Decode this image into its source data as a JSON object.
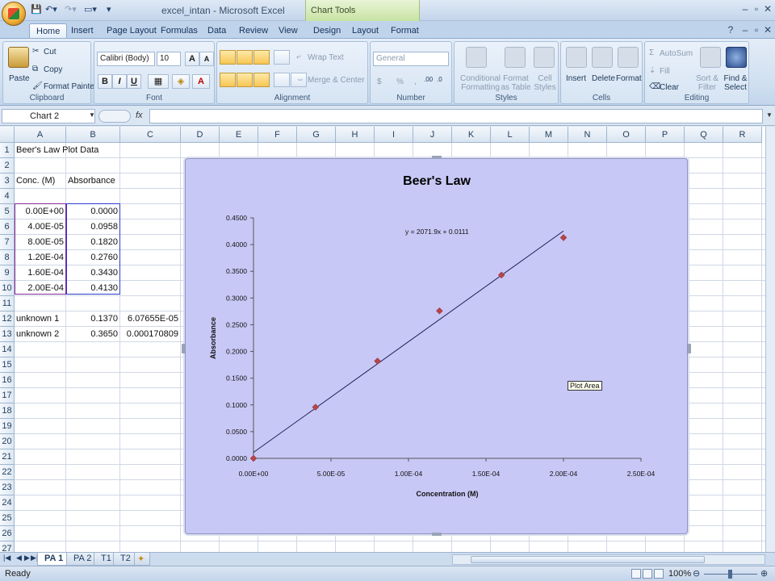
{
  "window": {
    "title": "excel_intan - Microsoft Excel",
    "contextual_tab": "Chart Tools"
  },
  "ribbon_tabs": [
    "Home",
    "Insert",
    "Page Layout",
    "Formulas",
    "Data",
    "Review",
    "View",
    "Design",
    "Layout",
    "Format"
  ],
  "ribbon": {
    "clipboard": {
      "paste": "Paste",
      "cut": "Cut",
      "copy": "Copy",
      "format_painter": "Format Painter",
      "label": "Clipboard"
    },
    "font": {
      "font_name": "Calibri (Body)",
      "font_size": "10",
      "bold": "B",
      "italic": "I",
      "underline": "U",
      "label": "Font"
    },
    "alignment": {
      "wrap_text": "Wrap Text",
      "merge_center": "Merge & Center",
      "label": "Alignment"
    },
    "number": {
      "format": "General",
      "currency": "$",
      "percent": "%",
      "comma": ",",
      "label": "Number"
    },
    "styles": {
      "conditional": "Conditional Formatting",
      "format_table": "Format as Table",
      "cell_styles": "Cell Styles",
      "label": "Styles"
    },
    "cells": {
      "insert": "Insert",
      "delete": "Delete",
      "format": "Format",
      "label": "Cells"
    },
    "editing": {
      "autosum": "AutoSum",
      "fill": "Fill",
      "clear": "Clear",
      "sort_filter": "Sort & Filter",
      "find_select": "Find & Select",
      "label": "Editing"
    }
  },
  "formula_bar": {
    "name_box": "Chart 2",
    "fx": "fx",
    "content": ""
  },
  "columns": [
    "A",
    "B",
    "C",
    "D",
    "E",
    "F",
    "G",
    "H",
    "I",
    "J",
    "K",
    "L",
    "M",
    "N",
    "O",
    "P",
    "Q",
    "R"
  ],
  "rows": [
    "1",
    "2",
    "3",
    "4",
    "5",
    "6",
    "7",
    "8",
    "9",
    "10",
    "11",
    "12",
    "13",
    "14",
    "15",
    "16",
    "17",
    "18",
    "19",
    "20",
    "21",
    "22",
    "23",
    "24",
    "25",
    "26",
    "27"
  ],
  "cells": {
    "A1": "Beer's Law Plot Data",
    "A3": "Conc. (M)",
    "B3": "Absorbance",
    "A5": "0.00E+00",
    "B5": "0.0000",
    "A6": "4.00E-05",
    "B6": "0.0958",
    "A7": "8.00E-05",
    "B7": "0.1820",
    "A8": "1.20E-04",
    "B8": "0.2760",
    "A9": "1.60E-04",
    "B9": "0.3430",
    "A10": "2.00E-04",
    "B10": "0.4130",
    "A12": "unknown 1",
    "B12": "0.1370",
    "C12": "6.07655E-05",
    "A13": "unknown 2",
    "B13": "0.3650",
    "C13": "0.000170809"
  },
  "chart_data": {
    "type": "scatter",
    "title": "Beer's Law",
    "xlabel": "Concentration (M)",
    "ylabel": "Absorbance",
    "x": [
      0,
      4e-05,
      8e-05,
      0.00012,
      0.00016,
      0.0002
    ],
    "y": [
      0,
      0.0958,
      0.182,
      0.276,
      0.343,
      0.413
    ],
    "trendline": {
      "slope": 2071.9,
      "intercept": 0.0111,
      "label": "y = 2071.9x + 0.0111"
    },
    "xlim": [
      0,
      0.00025
    ],
    "ylim": [
      0,
      0.45
    ],
    "xticks": [
      "0.00E+00",
      "5.00E-05",
      "1.00E-04",
      "1.50E-04",
      "2.00E-04",
      "2.50E-04"
    ],
    "yticks": [
      "0.0000",
      "0.0500",
      "0.1000",
      "0.1500",
      "0.2000",
      "0.2500",
      "0.3000",
      "0.3500",
      "0.4000",
      "0.4500"
    ],
    "grid": false,
    "marker_color": "#b5454a",
    "background": "#c8c8f6"
  },
  "tooltip": "Plot Area",
  "sheet_tabs": [
    "PA 1",
    "PA 2",
    "T1",
    "T2"
  ],
  "status": {
    "ready": "Ready",
    "zoom": "100%"
  }
}
